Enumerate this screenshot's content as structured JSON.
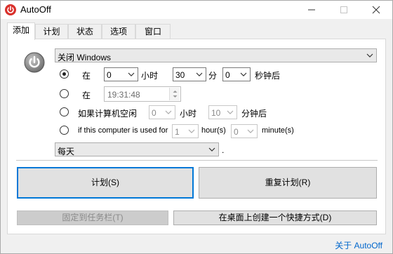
{
  "window": {
    "title": "AutoOff",
    "icon": "power-icon",
    "controls": [
      "minimize",
      "maximize",
      "close"
    ]
  },
  "tabs": [
    {
      "label": "添加",
      "active": true
    },
    {
      "label": "计划",
      "active": false
    },
    {
      "label": "状态",
      "active": false
    },
    {
      "label": "选项",
      "active": false
    },
    {
      "label": "窗口",
      "active": false
    }
  ],
  "action": {
    "selected": "关闭 Windows"
  },
  "schedule_options": {
    "after": {
      "checked": true,
      "prefix": "在",
      "hours_value": "0",
      "hours_label": "小时",
      "minutes_value": "30",
      "minutes_label": "分",
      "seconds_value": "0",
      "seconds_label": "秒钟后"
    },
    "at_time": {
      "checked": false,
      "prefix": "在",
      "time_value": "19:31:48"
    },
    "idle": {
      "checked": false,
      "prefix": "如果计算机空闲",
      "hours_value": "0",
      "hours_label": "小时",
      "minutes_value": "10",
      "minutes_label": "分钟后"
    },
    "used": {
      "checked": false,
      "prefix": "if this computer is used for",
      "hours_value": "1",
      "hours_label": "hour(s)",
      "minutes_value": "0",
      "minutes_label": "minute(s)"
    }
  },
  "repeat": {
    "selected": "每天",
    "suffix": "."
  },
  "buttons": {
    "schedule": "计划(S)",
    "repeat_schedule": "重复计划(R)",
    "pin_taskbar": "固定到任务栏(T)",
    "create_shortcut": "在桌面上创建一个快捷方式(D)"
  },
  "about_link": "关于 AutoOff",
  "colors": {
    "accent": "#0078d7",
    "app_icon": "#d9302b",
    "link": "#0066cc"
  }
}
